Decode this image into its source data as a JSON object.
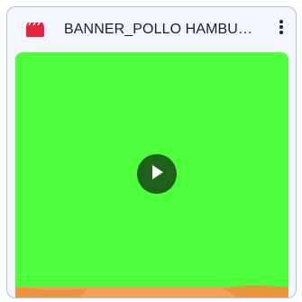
{
  "file": {
    "name": "BANNER_POLLO HAMBURG...",
    "type_icon": "video-clapper-icon",
    "icon_color": "#e8243a"
  },
  "actions": {
    "more_icon": "more-vert-icon"
  },
  "thumbnail": {
    "background_color": "#4cff3a",
    "play_icon": "play-icon",
    "play_button_color": "#1e5f19",
    "bottom_strip_color": "#f0a45a"
  },
  "card": {
    "border_color": "#a8c1f0",
    "background_color": "#f3f6fc"
  }
}
